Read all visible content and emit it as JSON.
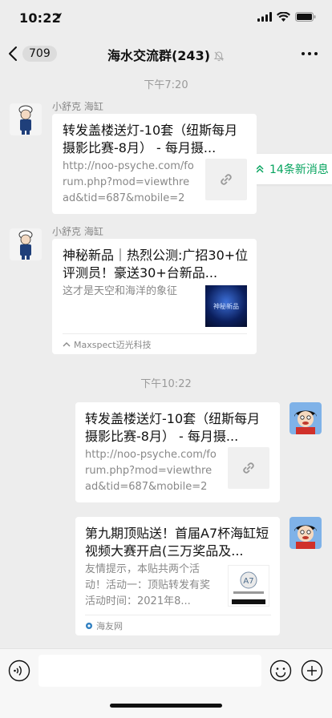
{
  "status_bar": {
    "time": "10:22"
  },
  "nav": {
    "back_count": "709",
    "title": "海水交流群(243)"
  },
  "new_messages": {
    "label": "14条新消息"
  },
  "timestamps": [
    "下午7:20",
    "下午10:22"
  ],
  "messages": [
    {
      "sender": "小舒克 海缸",
      "title": "转发盖楼送灯-10套（纽斯每月摄影比赛-8月） - 每月摄...",
      "desc": "http://noo-psyche.com/forum.php?mod=viewthread&tid=687&mobile=2",
      "thumb_icon": "link-icon"
    },
    {
      "sender": "小舒克 海缸",
      "title": "神秘新品｜热烈公测:广招30+位评测员！豪送30+台新品...",
      "desc": "这才是天空和海洋的象征",
      "thumb_text": "神秘新品",
      "source": "Maxspect迈光科技"
    },
    {
      "title": "转发盖楼送灯-10套（纽斯每月摄影比赛-8月） - 每月摄...",
      "desc": "http://noo-psyche.com/forum.php?mod=viewthread&tid=687&mobile=2",
      "thumb_icon": "link-icon"
    },
    {
      "title": "第九期顶贴送！首届A7杯海缸短视频大赛开启(三万奖品及...",
      "desc": "友情提示，本贴共两个活动！活动一：顶贴转发有奖活动时间：2021年8...",
      "source": "海友网"
    }
  ]
}
